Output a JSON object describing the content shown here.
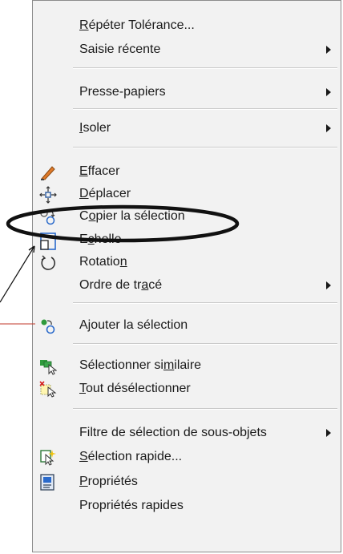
{
  "menu": {
    "repeat": {
      "pre": "",
      "u": "R",
      "post": "épéter Tolérance..."
    },
    "recent": {
      "pre": "Saisie récente",
      "u": "",
      "post": ""
    },
    "clipboard": {
      "pre": "Presse-papiers",
      "u": "",
      "post": ""
    },
    "isolate": {
      "pre": "",
      "u": "I",
      "post": "soler"
    },
    "erase": {
      "pre": "",
      "u": "E",
      "post": "ffacer"
    },
    "move": {
      "pre": "",
      "u": "D",
      "post": "éplacer"
    },
    "copy": {
      "pre": "C",
      "u": "o",
      "post": "pier la sélection"
    },
    "scale": {
      "pre": "E",
      "u": "c",
      "post": "helle"
    },
    "rotate": {
      "pre": "Rotatio",
      "u": "n",
      "post": ""
    },
    "draworder": {
      "pre": "Ordre de tr",
      "u": "a",
      "post": "cé"
    },
    "addsel": {
      "pre": "A",
      "u": "j",
      "post": "outer la sélection"
    },
    "similar": {
      "pre": "Sélectionner si",
      "u": "m",
      "post": "ilaire"
    },
    "deselect": {
      "pre": "",
      "u": "T",
      "post": "out désélectionner"
    },
    "subfilter": {
      "pre": "Filtre de sélection de sous-objets",
      "u": "",
      "post": ""
    },
    "quicksel": {
      "pre": "",
      "u": "S",
      "post": "élection rapide..."
    },
    "props": {
      "pre": "",
      "u": "P",
      "post": "ropriétés"
    },
    "quickprops": {
      "pre": "Propriétés rapides",
      "u": "",
      "post": ""
    }
  },
  "colors": {
    "menu_bg": "#f2f2f2",
    "border": "#8c8c8c",
    "annotation_line": "#c0392b",
    "highlight_ellipse": "#111111"
  },
  "icons": [
    "erase-icon",
    "move-icon",
    "copy-icon",
    "scale-icon",
    "rotate-icon",
    "add-selection-icon",
    "select-similar-icon",
    "deselect-all-icon",
    "quick-select-icon",
    "properties-icon"
  ]
}
